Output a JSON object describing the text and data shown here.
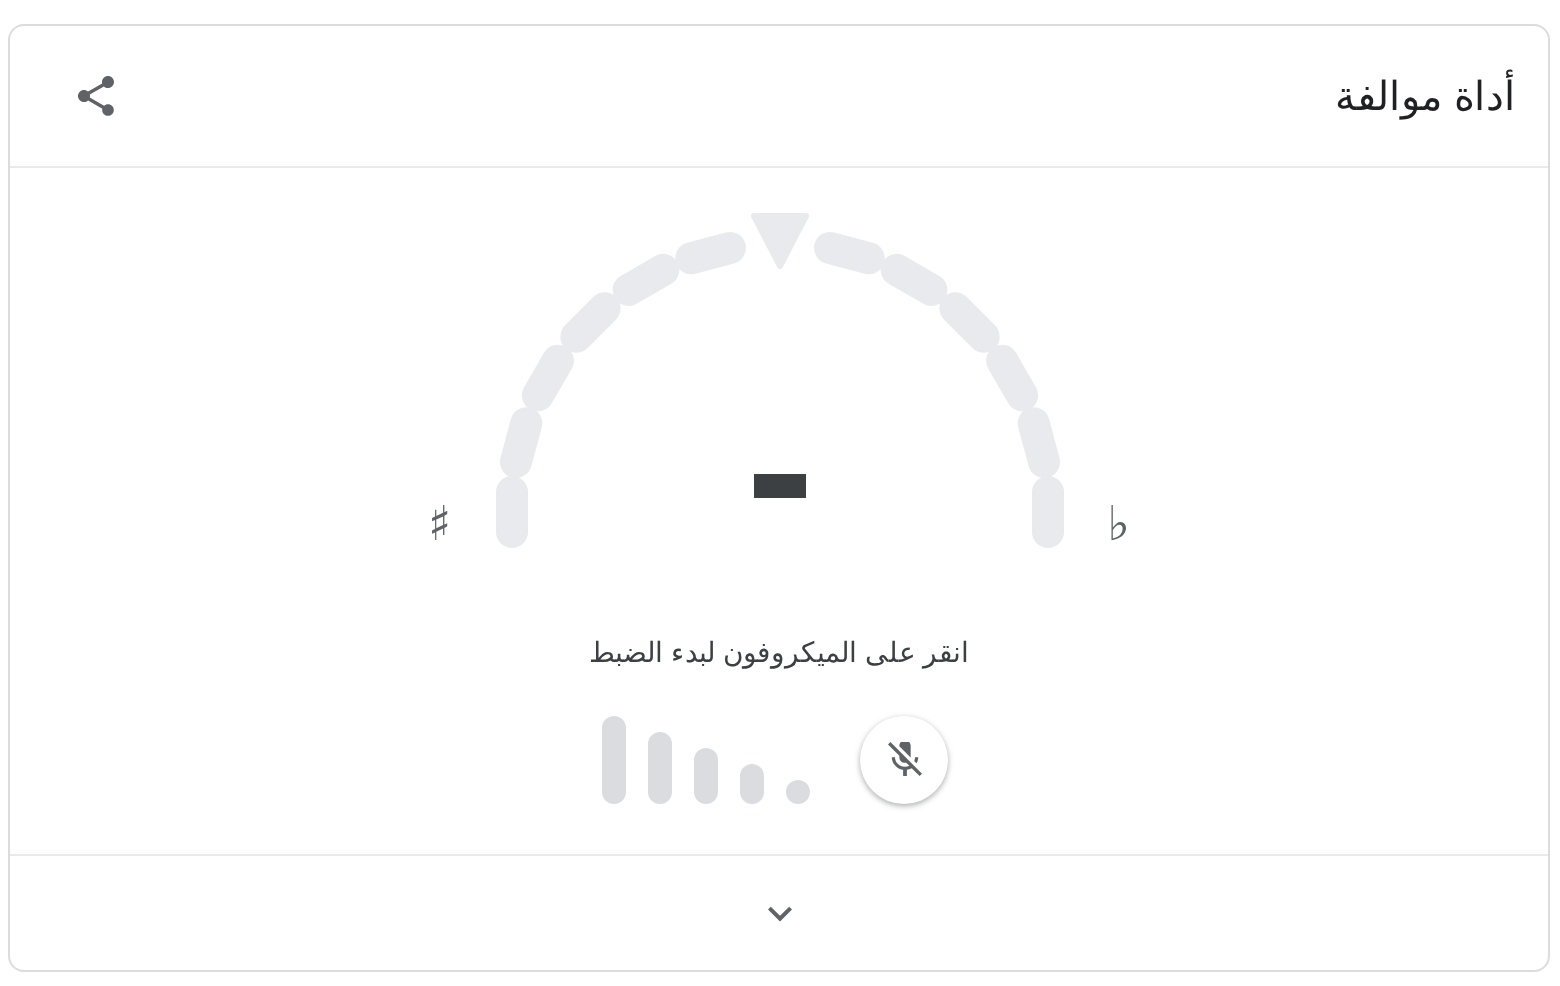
{
  "title": "أداة موالفة",
  "tuner": {
    "sharp_symbol": "♯",
    "flat_symbol": "♭",
    "instruction": "انقر على الميكروفون لبدء الضبط"
  },
  "footer": {
    "expanded": false
  }
}
